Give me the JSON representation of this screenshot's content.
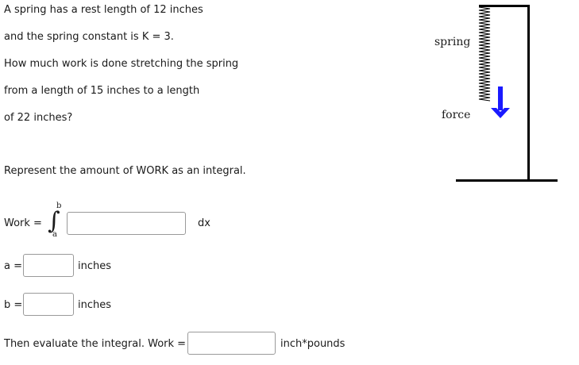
{
  "problem": {
    "lines": [
      "A spring has a rest length of 12 inches",
      "and the spring constant is K = 3.",
      "How much work is done stretching the spring",
      "from a length of 15 inches to a length",
      "of 22 inches?"
    ],
    "represent_text": "Represent the amount of WORK as an integral."
  },
  "integral": {
    "work_label": "Work =",
    "upper_limit": "b",
    "lower_limit": "a",
    "integrand_value": "",
    "dx_label": "dx"
  },
  "limits": {
    "a_label": "a =",
    "a_value": "",
    "a_unit": "inches",
    "b_label": "b =",
    "b_value": "",
    "b_unit": "inches"
  },
  "evaluate": {
    "label": "Then evaluate the integral. Work =",
    "value": "",
    "unit": "inch*pounds"
  },
  "figure": {
    "spring_label": "spring",
    "force_label": "force",
    "arrow_color": "#1a1aff"
  }
}
